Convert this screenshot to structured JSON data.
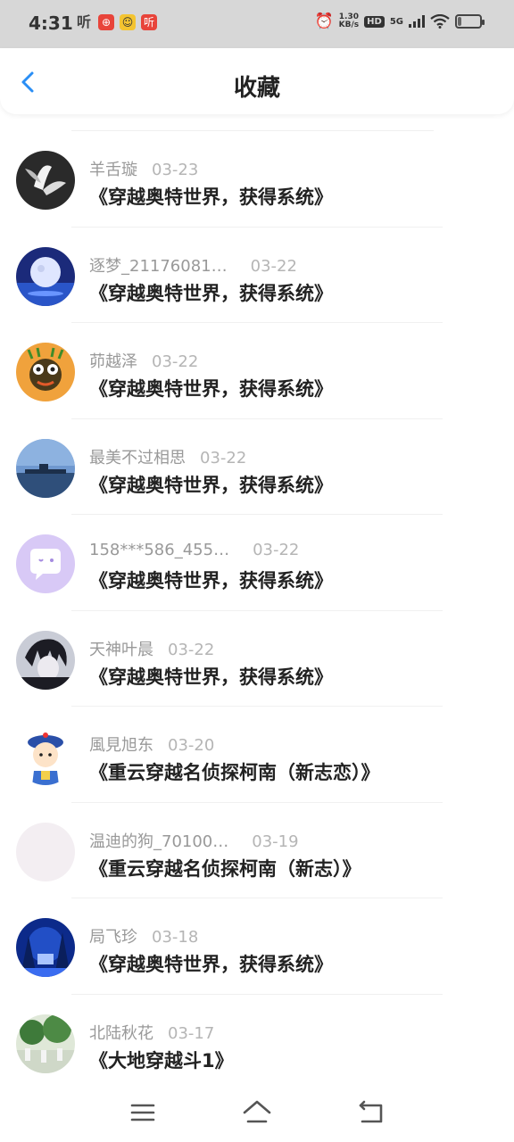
{
  "status": {
    "time": "4:31",
    "app_icons": [
      {
        "name": "listen-icon",
        "glyph": "听"
      },
      {
        "name": "app-red-icon",
        "glyph": "⊕"
      },
      {
        "name": "app-yellow-icon",
        "glyph": "☺"
      },
      {
        "name": "listen-red-icon",
        "glyph": "听"
      }
    ],
    "speed_top": "1.30",
    "speed_unit": "KB/s",
    "hd": "HD",
    "network": "5G",
    "battery_level": 0.15
  },
  "header": {
    "title": "收藏",
    "accent_color": "#2a8ef5"
  },
  "items": [
    {
      "username": "羊舌璇",
      "date": "03-23",
      "work": "《穿越奥特世界，获得系统》",
      "avatar": "lily-photo"
    },
    {
      "username": "逐梦_21176081…",
      "date": "03-22",
      "work": "《穿越奥特世界，获得系统》",
      "avatar": "moon-photo",
      "long": true
    },
    {
      "username": "茆越泽",
      "date": "03-22",
      "work": "《穿越奥特世界，获得系统》",
      "avatar": "cartoon-monster"
    },
    {
      "username": "最美不过相思",
      "date": "03-22",
      "work": "《穿越奥特世界，获得系统》",
      "avatar": "sea-photo"
    },
    {
      "username": "158***586_455…",
      "date": "03-22",
      "work": "《穿越奥特世界，获得系统》",
      "avatar": "default-chat-bubble",
      "long": true
    },
    {
      "username": "天神叶晨",
      "date": "03-22",
      "work": "《穿越奥特世界，获得系统》",
      "avatar": "anime-boy"
    },
    {
      "username": "風見旭东",
      "date": "03-20",
      "work": "《重云穿越名侦探柯南（新志恋）》",
      "avatar": "cartoon-qing-official"
    },
    {
      "username": "温迪的狗_70100…",
      "date": "03-19",
      "work": "《重云穿越名侦探柯南（新志）》",
      "avatar": "blank",
      "long": true
    },
    {
      "username": "局飞珍",
      "date": "03-18",
      "work": "《穿越奥特世界，获得系统》",
      "avatar": "blue-forest"
    },
    {
      "username": "北陆秋花",
      "date": "03-17",
      "work": "《大地穿越斗1》",
      "avatar": "garden-photo"
    }
  ]
}
